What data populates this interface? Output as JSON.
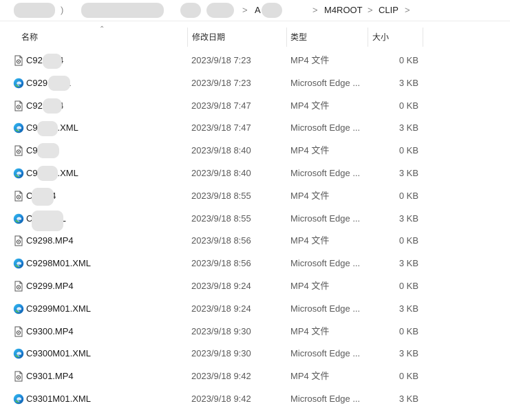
{
  "breadcrumb": {
    "segments": [
      {
        "label": "A"
      },
      {
        "label": "M4ROOT"
      },
      {
        "label": "CLIP"
      }
    ],
    "separator": ">",
    "trail_separator": ">"
  },
  "columns": {
    "name": "名称",
    "date": "修改日期",
    "type": "类型",
    "size": "大小"
  },
  "files": [
    {
      "name": "C92     MP4",
      "date": "2023/9/18 7:23",
      "type": "MP4 文件",
      "size": "0 KB",
      "icon": "video-file-icon"
    },
    {
      "name": "C929      .XML",
      "date": "2023/9/18 7:23",
      "type": "Microsoft Edge ...",
      "size": "3 KB",
      "icon": "edge-icon"
    },
    {
      "name": "C92     MP4",
      "date": "2023/9/18 7:47",
      "type": "MP4 文件",
      "size": "0 KB",
      "icon": "video-file-icon"
    },
    {
      "name": "C9      M01.XML",
      "date": "2023/9/18 7:47",
      "type": "Microsoft Edge ...",
      "size": "3 KB",
      "icon": "edge-icon"
    },
    {
      "name": "C9      MP4",
      "date": "2023/9/18 8:40",
      "type": "MP4 文件",
      "size": "0 KB",
      "icon": "video-file-icon"
    },
    {
      "name": "C9      M01.XML",
      "date": "2023/9/18 8:40",
      "type": "Microsoft Edge ...",
      "size": "3 KB",
      "icon": "edge-icon"
    },
    {
      "name": "C      .MP4",
      "date": "2023/9/18 8:55",
      "type": "MP4 文件",
      "size": "0 KB",
      "icon": "video-file-icon"
    },
    {
      "name": "C      01.XML",
      "date": "2023/9/18 8:55",
      "type": "Microsoft Edge ...",
      "size": "3 KB",
      "icon": "edge-icon"
    },
    {
      "name": "C9298.MP4",
      "date": "2023/9/18 8:56",
      "type": "MP4 文件",
      "size": "0 KB",
      "icon": "video-file-icon"
    },
    {
      "name": "C9298M01.XML",
      "date": "2023/9/18 8:56",
      "type": "Microsoft Edge ...",
      "size": "3 KB",
      "icon": "edge-icon"
    },
    {
      "name": "C9299.MP4",
      "date": "2023/9/18 9:24",
      "type": "MP4 文件",
      "size": "0 KB",
      "icon": "video-file-icon"
    },
    {
      "name": "C9299M01.XML",
      "date": "2023/9/18 9:24",
      "type": "Microsoft Edge ...",
      "size": "3 KB",
      "icon": "edge-icon"
    },
    {
      "name": "C9300.MP4",
      "date": "2023/9/18 9:30",
      "type": "MP4 文件",
      "size": "0 KB",
      "icon": "video-file-icon"
    },
    {
      "name": "C9300M01.XML",
      "date": "2023/9/18 9:30",
      "type": "Microsoft Edge ...",
      "size": "3 KB",
      "icon": "edge-icon"
    },
    {
      "name": "C9301.MP4",
      "date": "2023/9/18 9:42",
      "type": "MP4 文件",
      "size": "0 KB",
      "icon": "video-file-icon"
    },
    {
      "name": "C9301M01.XML",
      "date": "2023/9/18 9:42",
      "type": "Microsoft Edge ...",
      "size": "3 KB",
      "icon": "edge-icon"
    }
  ]
}
